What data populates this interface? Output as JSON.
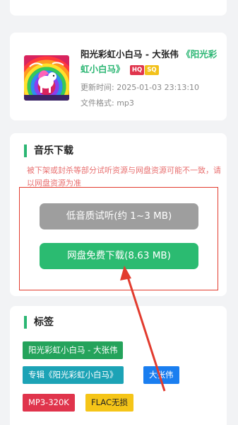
{
  "song": {
    "title": "阳光彩虹小白马 - 大张伟",
    "album_title": "《阳光彩虹小白马》",
    "badge_hq": "HQ",
    "badge_sq": "SQ",
    "update_label": "更新时间:",
    "update_value": "2025-01-03 23:13:10",
    "format_label": "文件格式:",
    "format_value": "mp3"
  },
  "download": {
    "section_title": "音乐下载",
    "notice": "被下架或封杀等部分试听资源与网盘资源可能不一致，请以网盘资源为准",
    "preview_button": "低音质试听(约 1~3 MB)",
    "download_button": "网盘免费下载(8.63 MB)"
  },
  "tags": {
    "section_title": "标签",
    "items": [
      "阳光彩虹小白马 - 大张伟",
      "专辑《阳光彩虹小白马》",
      "大张伟",
      "MP3-320K",
      "FLAC无损"
    ]
  },
  "colors": {
    "accent_green": "#2bb673",
    "annotation_red": "#e23b2e",
    "download_button": "#2bbb71",
    "preview_button": "#9e9e9e"
  }
}
